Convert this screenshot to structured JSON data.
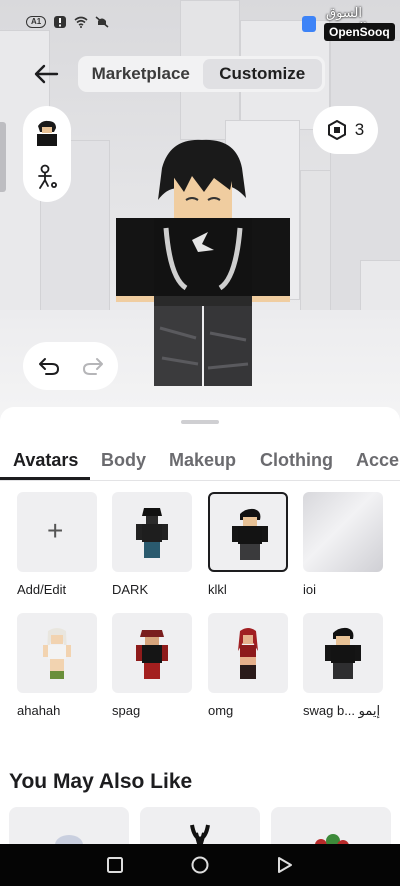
{
  "status_bar": {
    "ai_badge": "A1"
  },
  "watermark": {
    "arabic": "السوق المفتوح",
    "brand": "OpenSooq"
  },
  "header": {
    "tabs": [
      {
        "label": "Marketplace",
        "active": false
      },
      {
        "label": "Customize",
        "active": true
      }
    ]
  },
  "robux": {
    "count": "3"
  },
  "sheet": {
    "tabs": [
      "Avatars",
      "Body",
      "Makeup",
      "Clothing",
      "Acce"
    ],
    "active_tab": "Avatars",
    "avatars": [
      {
        "label": "Add/Edit",
        "kind": "add"
      },
      {
        "label": "DARK",
        "kind": "avatar"
      },
      {
        "label": "klkl",
        "kind": "avatar",
        "selected": true
      },
      {
        "label": "ioi",
        "kind": "blank"
      },
      {
        "label": "ahahah",
        "kind": "avatar"
      },
      {
        "label": "spag",
        "kind": "avatar"
      },
      {
        "label": "omg",
        "kind": "avatar"
      },
      {
        "label": "swag b... إيمو",
        "kind": "avatar"
      }
    ],
    "section_title": "You May Also Like"
  },
  "colors": {
    "accent": "#1d1d1f",
    "sheet_bg": "#ffffff",
    "card_bg": "#efeff1",
    "navbar": "#050505"
  },
  "icons": [
    "back-arrow-icon",
    "robux-icon",
    "undo-icon",
    "redo-icon",
    "plus-icon",
    "nav-recents-icon",
    "nav-home-icon",
    "nav-back-icon"
  ]
}
